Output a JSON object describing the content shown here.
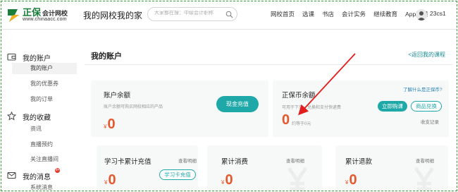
{
  "header": {
    "logo_brand": "正保",
    "logo_brand_sub": "会计网校",
    "logo_url": "www.chinaacc.com",
    "site_title": "我的网校我的家",
    "search_placeholder": "大家都在搜：中级会计职称",
    "nav": [
      "网校首页",
      "选课",
      "书店",
      "会计实务",
      "继续教育",
      "App看课"
    ],
    "username": "23cs1"
  },
  "sidebar": {
    "groups": [
      {
        "title": "我的账户",
        "icon": "wallet-icon",
        "items": [
          "我的账户",
          "我的优惠券",
          "我的订单"
        ]
      },
      {
        "title": "我的收藏",
        "icon": "star-icon",
        "items": [
          "资讯",
          "直播预约",
          "关注直播间"
        ]
      },
      {
        "title": "我的消息",
        "icon": "mail-icon",
        "badge": "9+",
        "items": [
          "系统消息"
        ]
      }
    ]
  },
  "main": {
    "page_title": "我的账户",
    "back_link": "<返回我的课程",
    "balance": {
      "title": "账户余额",
      "desc": "账户余额可购买网校相应的产品",
      "currency": "¥",
      "amount": "0",
      "button": "现金充值"
    },
    "coins": {
      "title": "正保币余额",
      "desc": "可用于下单、兑换和支付快递费",
      "help_link": "了解什么是正保币?",
      "amount": "0",
      "equiv": "约等于0元",
      "buy_button": "立即购课",
      "exchange_button": "商品兑换",
      "record_link": "收支记录"
    },
    "bottom_cards": [
      {
        "title": "学习卡累计充值",
        "detail": "查看明细",
        "button": "学习卡充值",
        "currency": "¥",
        "amount": "0"
      },
      {
        "title": "累计消费",
        "detail": "查看明细",
        "currency": "¥",
        "amount": "0"
      },
      {
        "title": "累计退款",
        "detail": "查看明细",
        "currency": "¥",
        "amount": "0"
      }
    ]
  },
  "colors": {
    "accent": "#1fa8a8",
    "amount": "#e5582d",
    "arrow": "#e11d1d",
    "frame": "#3b9b3b"
  }
}
